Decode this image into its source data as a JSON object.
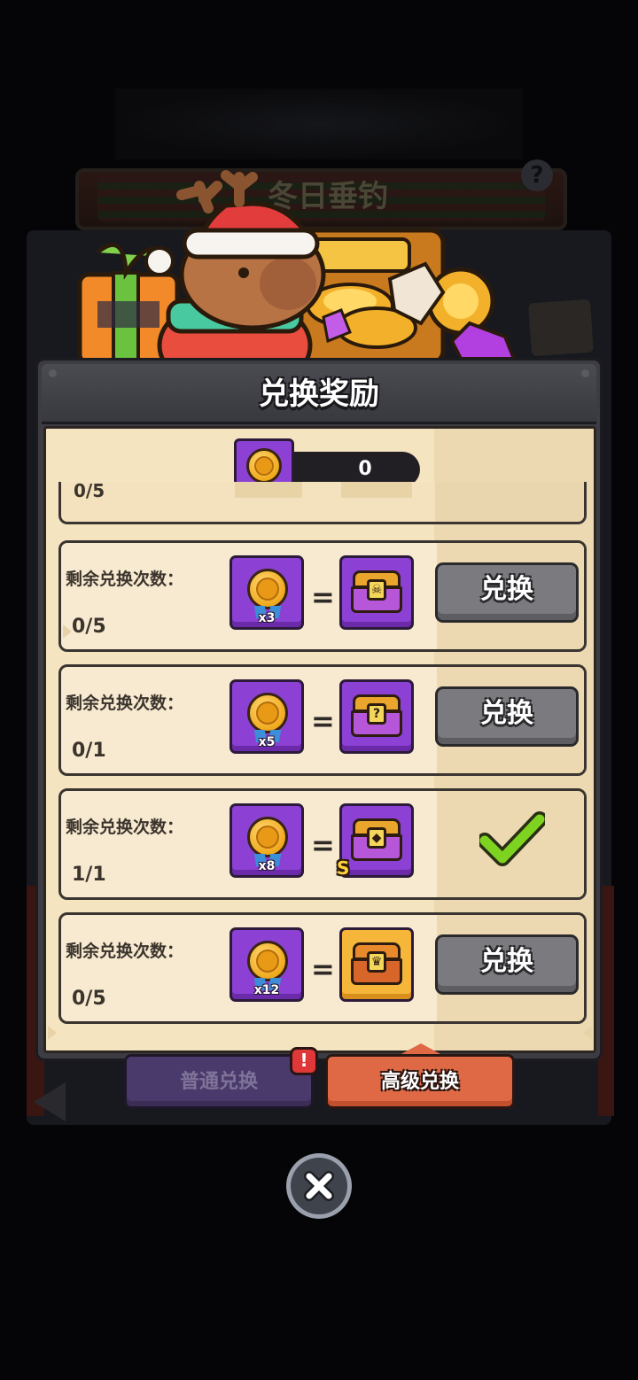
{
  "background": {
    "event_title": "冬日垂钓",
    "help_symbol": "?"
  },
  "modal": {
    "title": "兑换奖励",
    "currency_amount": "0",
    "cut_row_count": "0/5",
    "rows": [
      {
        "label": "剩余兑换次数：",
        "count": "0/5",
        "cost_qty": "x3",
        "reward": "purple-chest-skull",
        "state": "button",
        "button_label": "兑换"
      },
      {
        "label": "剩余兑换次数：",
        "count": "0/1",
        "cost_qty": "x5",
        "reward": "purple-chest-mystery",
        "state": "button",
        "button_label": "兑换"
      },
      {
        "label": "剩余兑换次数：",
        "count": "1/1",
        "cost_qty": "x8",
        "reward": "purple-chest-s-grade",
        "reward_tag": "S",
        "state": "done",
        "button_label": ""
      },
      {
        "label": "剩余兑换次数：",
        "count": "0/5",
        "cost_qty": "x12",
        "reward": "gold-chest-trophy",
        "state": "button",
        "button_label": "兑换"
      }
    ],
    "equals_symbol": "="
  },
  "tabs": {
    "normal_label": "普通兑换",
    "advanced_label": "高级兑换",
    "alert_symbol": "!"
  },
  "colors": {
    "panel_cream": "#f4e4c0",
    "token_purple": "#8c41d4",
    "button_gray": "#7b7b7f",
    "tab_active": "#e06945",
    "tab_inactive": "#4a3a6b",
    "check_green": "#7ed321"
  },
  "icons": [
    "fish-coin-icon",
    "chest-icon",
    "check-icon",
    "close-icon",
    "alert-icon"
  ]
}
